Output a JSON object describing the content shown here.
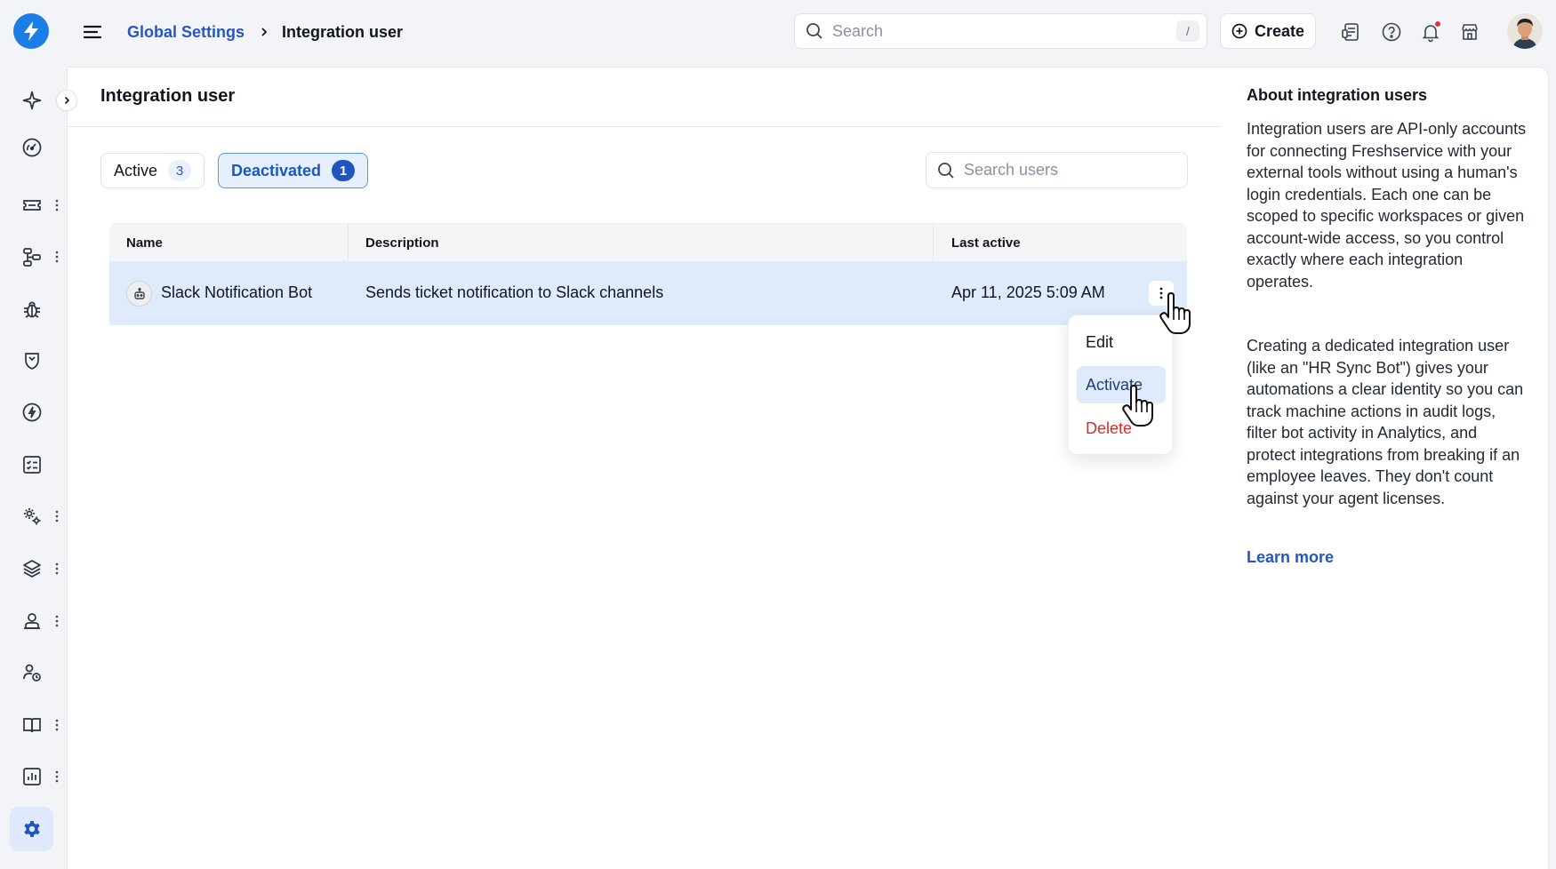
{
  "header": {
    "breadcrumb": {
      "parent": "Global Settings",
      "current": "Integration user"
    },
    "search": {
      "placeholder": "Search",
      "shortcut": "/"
    },
    "create_label": "Create",
    "icons": [
      "form-icon",
      "help-icon",
      "bell-icon",
      "marketplace-icon"
    ],
    "has_notification": true
  },
  "sidebar": {
    "items": [
      {
        "icon": "sparkle-icon",
        "has_menu": false
      },
      {
        "icon": "dashboard-icon",
        "has_menu": false
      },
      {
        "icon": "ticket-icon",
        "has_menu": true
      },
      {
        "icon": "workflow-icon",
        "has_menu": true
      },
      {
        "icon": "bug-icon",
        "has_menu": false
      },
      {
        "icon": "shield-icon",
        "has_menu": false
      },
      {
        "icon": "change-icon",
        "has_menu": false
      },
      {
        "icon": "checklist-icon",
        "has_menu": false
      },
      {
        "icon": "cog-group-icon",
        "has_menu": true
      },
      {
        "icon": "layers-icon",
        "has_menu": true
      },
      {
        "icon": "agent-icon",
        "has_menu": true
      },
      {
        "icon": "user-time-icon",
        "has_menu": false
      },
      {
        "icon": "book-icon",
        "has_menu": true
      },
      {
        "icon": "chart-icon",
        "has_menu": true
      },
      {
        "icon": "settings-icon",
        "active": true
      }
    ]
  },
  "main": {
    "title": "Integration user",
    "tabs": [
      {
        "label": "Active",
        "count": "3",
        "selected": false
      },
      {
        "label": "Deactivated",
        "count": "1",
        "selected": true
      }
    ],
    "search_placeholder": "Search users",
    "table": {
      "columns": [
        "Name",
        "Description",
        "Last active"
      ],
      "rows": [
        {
          "name": "Slack Notification Bot",
          "description": "Sends ticket notification to Slack channels",
          "last_active": "Apr 11, 2025 5:09 AM"
        }
      ]
    },
    "row_menu": {
      "items": [
        {
          "label": "Edit"
        },
        {
          "label": "Activate",
          "hovered": true
        },
        {
          "label": "Delete",
          "danger": true
        }
      ]
    }
  },
  "side_panel": {
    "title": "About integration users",
    "paragraphs": [
      "Integration users are API-only accounts for connecting Freshservice with your external tools without using a human's login credentials. Each one can be scoped to specific workspaces or given account-wide access, so you control exactly where each integration operates.",
      "Creating a dedicated integration user (like an \"HR Sync Bot\") gives your automations a clear identity so you can track machine actions in audit logs, filter bot activity in Analytics, and protect integrations from breaking if an employee leaves. They don't count against your agent licenses."
    ],
    "link": "Learn more"
  },
  "colors": {
    "accent": "#1f55c2",
    "link": "#2457c5",
    "selected_row": "#dfeafb",
    "danger": "#d62f2f",
    "logo": "#1b7ee6"
  }
}
